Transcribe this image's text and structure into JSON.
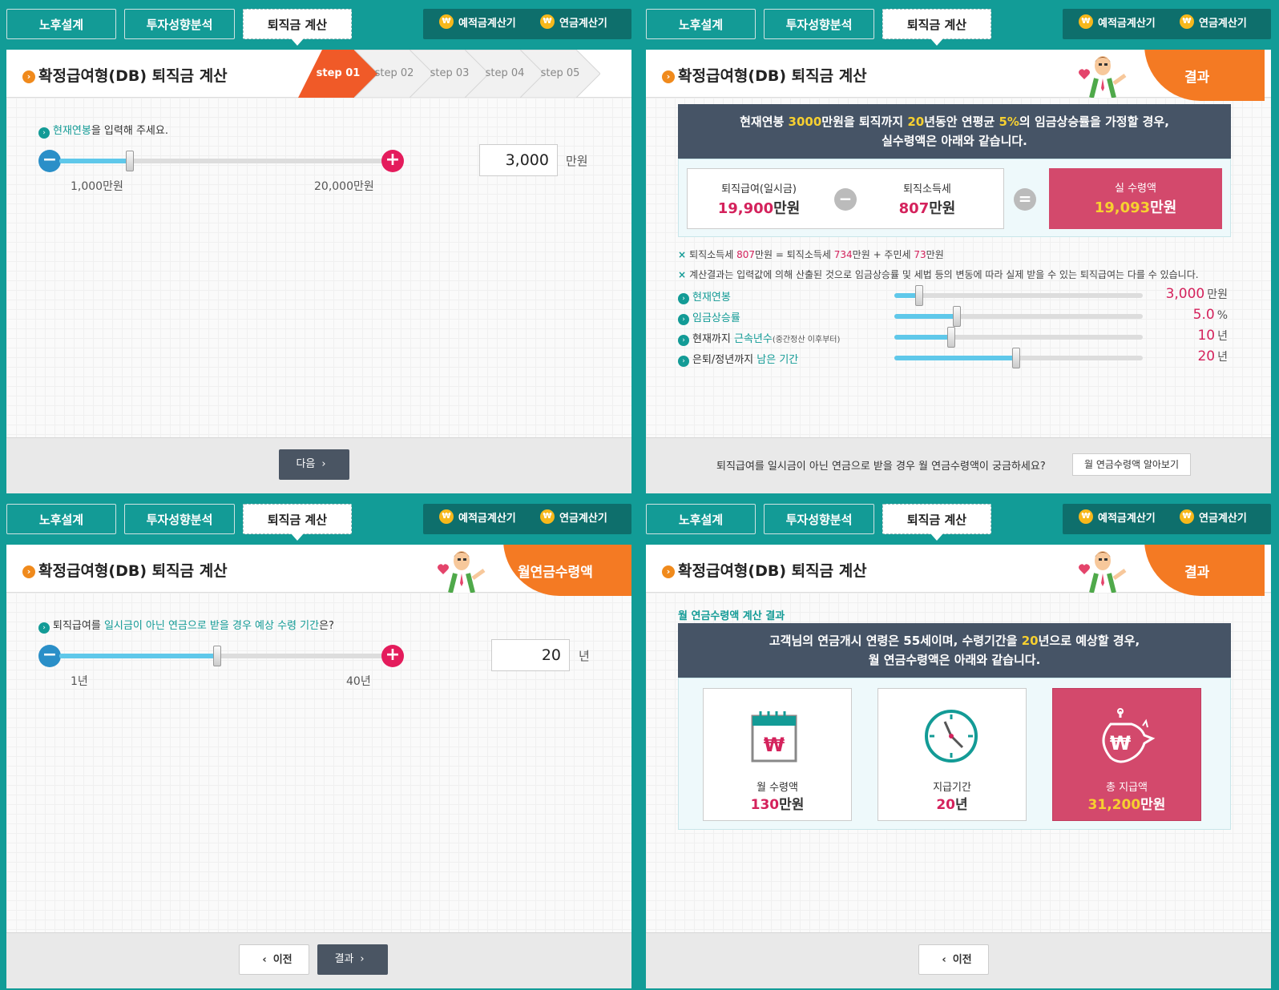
{
  "tabs": [
    "노후설계",
    "투자성향분석",
    "퇴직금 계산"
  ],
  "calculators": [
    "예적금계산기",
    "연금계산기"
  ],
  "coin_symbol": "₩",
  "title": "확정급여형(DB) 퇴직금 계산",
  "colors": {
    "teal": "#129c97",
    "orange": "#f47a23",
    "pink": "#d4225c",
    "navy": "#465466"
  },
  "panel1": {
    "steps": [
      "step 01",
      "step 02",
      "step 03",
      "step 04",
      "step 05"
    ],
    "active_step": 1,
    "question_hl": "현재연봉",
    "question_rest": "을 입력해 주세요.",
    "slider": {
      "min_label": "1,000만원",
      "max_label": "20,000만원",
      "value": 3000,
      "min": 1000,
      "max": 20000
    },
    "input_value": "3,000",
    "unit": "만원",
    "next_label": "다음"
  },
  "panel2": {
    "badge": "결과",
    "banner_parts": [
      "현재연봉 ",
      "3000",
      "만원을 퇴직까지 ",
      "20",
      "년동안 연평균 ",
      "5%",
      "의 임금상승률을 가정할 경우,"
    ],
    "banner_line2": "실수령액은 아래와 같습니다.",
    "lump_label": "퇴직급여(일시금)",
    "lump_num": "19,900",
    "lump_unit": "만원",
    "tax_label": "퇴직소득세",
    "tax_num": "807",
    "tax_unit": "만원",
    "net_label": "실 수령액",
    "net_num": "19,093",
    "net_unit": "만원",
    "note1_parts": [
      "퇴직소득세 ",
      "807",
      "만원 = 퇴직소득세 ",
      "734",
      "만원 + 주민세 ",
      "73",
      "만원"
    ],
    "note2": "계산결과는 입력값에 의해 산출된 것으로 임금상승률 및 세법 등의 변동에 따라 실제 받을 수 있는 퇴직급여는 다를 수 있습니다.",
    "sliders": [
      {
        "pre": "",
        "hl": "현재연봉",
        "post": "",
        "small": "",
        "value": "3,000",
        "unit": "만원",
        "fraction": 0.1
      },
      {
        "pre": "",
        "hl": "임금상승률",
        "post": "",
        "small": "",
        "value": "5.0",
        "unit": "%",
        "fraction": 0.25
      },
      {
        "pre": "현재까지 ",
        "hl": "근속년수",
        "post": "",
        "small": "(중간정산 이후부터)",
        "value": "10",
        "unit": "년",
        "fraction": 0.23
      },
      {
        "pre": "은퇴/정년까지 ",
        "hl": "남은 기간",
        "post": "",
        "small": "",
        "value": "20",
        "unit": "년",
        "fraction": 0.49
      }
    ],
    "footer_text": "퇴직급여를 일시금이 아닌 연금으로 받을 경우 월 연금수령액이 궁금하세요?",
    "footer_button": "월 연금수령액 알아보기"
  },
  "panel3": {
    "badge": "월연금수령액",
    "question_parts": [
      "퇴직급여를 ",
      "일시금이 아닌 연금으로 받을 경우 예상 수령 기간",
      "은?"
    ],
    "slider": {
      "min_label": "1년",
      "max_label": "40년",
      "value": 20,
      "min": 1,
      "max": 40
    },
    "input_value": "20",
    "unit": "년",
    "prev_label": "이전",
    "result_label": "결과"
  },
  "panel4": {
    "badge": "결과",
    "subtitle": "월 연금수령액 계산 결과",
    "banner_parts": [
      "고객님의 연금개시 연령은 55세이며, 수령기간을 ",
      "20",
      "년으로 예상할 경우,"
    ],
    "banner_line2": "월 연금수령액은 아래와 같습니다.",
    "cards": [
      {
        "label": "월 수령액",
        "num": "130",
        "unit": "만원",
        "icon": "calendar-won-icon"
      },
      {
        "label": "지급기간",
        "num": "20",
        "unit": "년",
        "icon": "clock-icon"
      },
      {
        "label": "총 지급액",
        "num": "31,200",
        "unit": "만원",
        "icon": "money-bag-icon"
      }
    ],
    "prev_label": "이전"
  }
}
